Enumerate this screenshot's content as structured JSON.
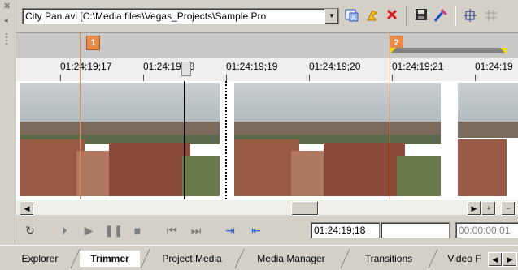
{
  "window": {
    "close_glyph": "✕",
    "collapse_glyph": "◂"
  },
  "toolbar": {
    "file_path": "City Pan.avi   [C:\\Media files\\Vegas_Projects\\Sample Pro",
    "dropdown_glyph": "▼",
    "icons": [
      "add-to-project-media-icon",
      "auto-marker-icon",
      "remove-icon",
      "save-icon",
      "properties-icon",
      "region-select-icon",
      "grid-icon"
    ]
  },
  "markers": [
    {
      "label": "1"
    },
    {
      "label": "2"
    }
  ],
  "ruler": {
    "labels": [
      "01:24:19;17",
      "01:24:19;18",
      "01:24:19;19",
      "01:24:19;20",
      "01:24:19;21",
      "01:24:19"
    ]
  },
  "scrollbar": {
    "left_glyph": "◀",
    "right_glyph": "▶",
    "plus_glyph": "+",
    "minus_glyph": "−"
  },
  "transport": {
    "buttons": {
      "loop": "↻",
      "play_from_start": "⏵",
      "play": "▶",
      "pause": "❚❚",
      "stop": "■",
      "prev": "⏮",
      "next": "⏭",
      "add_to_timeline_start": "⇥",
      "add_to_timeline_end": "⇤"
    },
    "cursor_time": "01:24:19;18",
    "selection_length": "00:00:00;01"
  },
  "tabs": [
    "Explorer",
    "Trimmer",
    "Project Media",
    "Media Manager",
    "Transitions",
    "Video F"
  ],
  "active_tab": "Trimmer",
  "colors": {
    "marker": "#e88a4a",
    "region": "#f2e600",
    "accent": "#3060c8"
  }
}
